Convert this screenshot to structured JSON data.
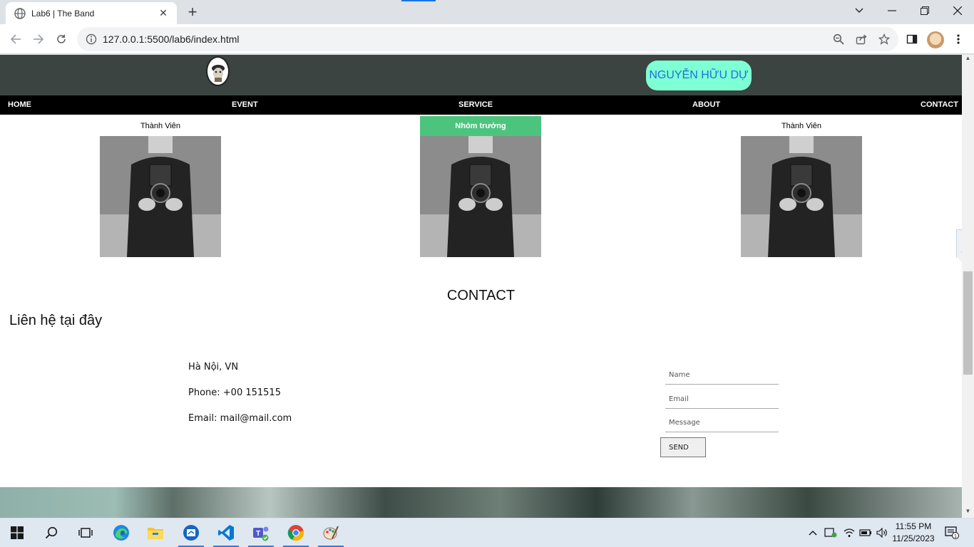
{
  "browser": {
    "tab_title": "Lab6 | The Band",
    "url": "127.0.0.1:5500/lab6/index.html"
  },
  "page": {
    "header": {
      "name_badge": "NGUYỄN HỮU DỰ"
    },
    "nav": [
      "HOME",
      "EVENT",
      "SERVICE",
      "ABOUT",
      "CONTACT"
    ],
    "members": [
      {
        "label": "Thành Viên",
        "leader": false
      },
      {
        "label": "Nhóm trưởng",
        "leader": true
      },
      {
        "label": "Thành Viên",
        "leader": false
      }
    ],
    "contact": {
      "title": "CONTACT",
      "subtitle": "Liên hệ tại đây",
      "location": "Hà Nội, VN",
      "phone": "Phone: +00 151515",
      "email": "Email: mail@mail.com",
      "form": {
        "name_placeholder": "Name",
        "email_placeholder": "Email",
        "message_placeholder": "Message",
        "send_label": "SEND"
      }
    }
  },
  "taskbar": {
    "time": "11:55 PM",
    "date": "11/25/2023",
    "notification_count": "1"
  },
  "colors": {
    "header_bg": "#3b4440",
    "nav_bg": "#000000",
    "badge_bg": "#7fffd4",
    "badge_text": "#1e6fd9",
    "leader_bg": "#4cc47e"
  },
  "icons": [
    "globe-icon",
    "close-icon",
    "plus-icon",
    "back-icon",
    "forward-icon",
    "reload-icon",
    "info-icon",
    "zoom-icon",
    "share-icon",
    "star-icon",
    "sidepanel-icon",
    "menu-icon",
    "windows-icon",
    "search-icon",
    "taskview-icon",
    "edge-icon",
    "explorer-icon",
    "vscode-icon",
    "teams-icon",
    "chrome-icon"
  ]
}
